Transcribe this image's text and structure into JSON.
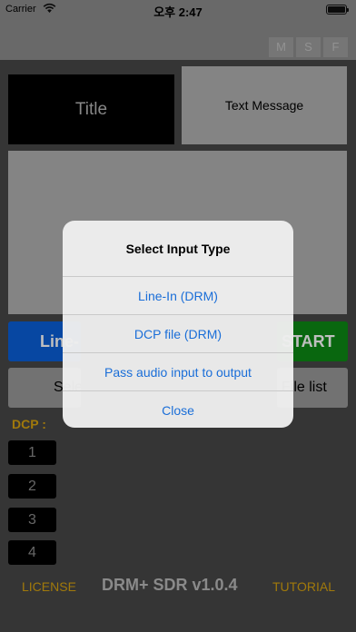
{
  "status_bar": {
    "carrier": "Carrier",
    "time": "오후 2:47"
  },
  "nav": {
    "buttons": [
      "M",
      "S",
      "F"
    ]
  },
  "display": {
    "title": "Title",
    "text_message": "Text Message"
  },
  "controls": {
    "linein_label": "Line-In",
    "start_label": "START",
    "s_label": "Select",
    "list_label": "File list"
  },
  "dcp": {
    "label": "DCP :",
    "slots": [
      "1",
      "2",
      "3",
      "4"
    ]
  },
  "footer": {
    "license": "LICENSE",
    "app_version": "DRM+ SDR v1.0.4",
    "tutorial": "TUTORIAL"
  },
  "alert": {
    "title": "Select Input Type",
    "actions": [
      "Line-In (DRM)",
      "DCP file (DRM)",
      "Pass audio input to output",
      "Close"
    ]
  },
  "colors": {
    "accent": "#d6a20f",
    "blue_button": "#0a5fd9",
    "green_button": "#0c8a14",
    "alert_link": "#1a6ed8"
  }
}
